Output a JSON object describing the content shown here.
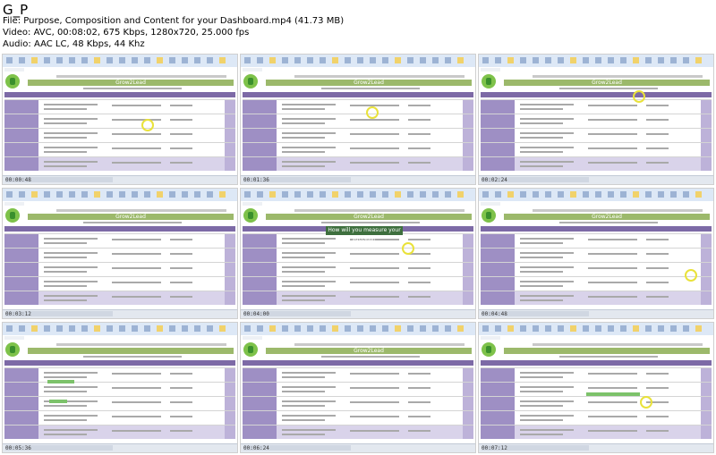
{
  "header": {
    "title": "G_P",
    "file": "File: Purpose, Composition and Content for your Dashboard.mp4 (41.73 MB)",
    "video": "Video: AVC, 00:08:02, 675 Kbps, 1280x720, 25.000 fps",
    "audio": "Audio: AAC LC, 48 Kbps, 44 Khz"
  },
  "thumbnails": [
    {
      "id": 1,
      "banner": "Grow2Lead",
      "timestamp": "00:00:48",
      "tooltip": ""
    },
    {
      "id": 2,
      "banner": "Grow2Lead",
      "timestamp": "00:01:36",
      "tooltip": ""
    },
    {
      "id": 3,
      "banner": "Grow2Lead",
      "timestamp": "00:02:24",
      "tooltip": ""
    },
    {
      "id": 4,
      "banner": "Grow2Lead",
      "timestamp": "00:03:12",
      "tooltip": ""
    },
    {
      "id": 5,
      "banner": "Grow2Lead",
      "timestamp": "00:04:00",
      "tooltip": "How will you measure your success?"
    },
    {
      "id": 6,
      "banner": "Grow2Lead",
      "timestamp": "00:04:48",
      "tooltip": ""
    },
    {
      "id": 7,
      "banner": "",
      "timestamp": "00:05:36",
      "tooltip": ""
    },
    {
      "id": 8,
      "banner": "Grow2Lead",
      "timestamp": "00:06:24",
      "tooltip": ""
    },
    {
      "id": 9,
      "banner": "",
      "timestamp": "00:07:12",
      "tooltip": ""
    }
  ],
  "colors": {
    "ribbon": "#dde8f6",
    "banner": "#9cb96b",
    "purple_header": "#7d6aa6",
    "purple_cell": "#9e8fc4",
    "highlight_ring": "#e9e23a",
    "tooltip_bg": "#3e6f3e"
  }
}
